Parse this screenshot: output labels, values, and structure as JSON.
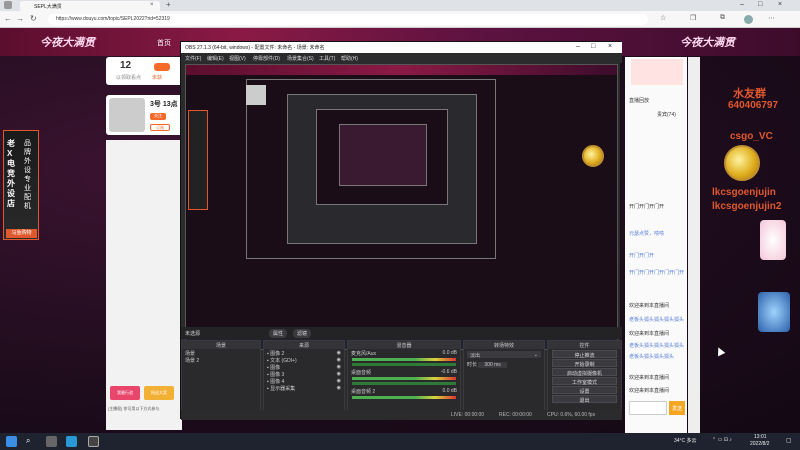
{
  "browser": {
    "tab_title": "SEPL大满贯",
    "url": "https://www.douyu.com/topic/SEPL2022?rid=52319"
  },
  "site": {
    "nav_home": "首页",
    "logo_left": "今夜大满贯",
    "logo_right": "今夜大满贯"
  },
  "follow_card": {
    "count": "12",
    "label": "以领取看点",
    "badge": "未获"
  },
  "room_card": {
    "title": "3号 13点",
    "follow": "关注",
    "subscribe": "订阅"
  },
  "left_ad": {
    "col1": "老X电竞外设店",
    "col2": "品牌外设 专业配机",
    "button": "马鱼购物"
  },
  "left_panel": {
    "bottom_label": "我最行战",
    "bottom_label2": "抢送大奖",
    "footer": "[主播权] 你可用以下方式参与"
  },
  "obs": {
    "title": "OBS 27.1.3 (64-bit, windows) - 配置文件: 未命名 - 场景: 未命名",
    "menu": [
      "文件(F)",
      "编辑(E)",
      "视图(V)",
      "停靠部件(D)",
      "场景集合(S)",
      "工具(T)",
      "帮助(H)"
    ],
    "scene_bar_label": "未选源",
    "scene_bar_props": "属性",
    "scene_bar_filters": "滤镜",
    "docks": {
      "scenes": {
        "header": "场景",
        "items": [
          "场景",
          "场景 2"
        ]
      },
      "sources": {
        "header": "来源",
        "items": [
          "图像 2",
          "文本 (GDI+)",
          "图像",
          "图像 3",
          "图像 4",
          "显示器采集"
        ]
      },
      "mixer": {
        "header": "混音器",
        "tracks": [
          {
            "name": "麦克风/Aux",
            "db": "0.0 dB"
          },
          {
            "name": "桌面音频",
            "db": "-0.6 dB"
          },
          {
            "name": "桌面音频 2",
            "db": "0.0 dB"
          }
        ]
      },
      "transitions": {
        "header": "转场特效",
        "type": "淡出",
        "duration_label": "时长",
        "duration": "300 ms"
      },
      "controls": {
        "header": "控件",
        "buttons": [
          "停止推流",
          "开始录制",
          "启动虚拟摄像机",
          "工作室模式",
          "设置",
          "退出"
        ]
      }
    },
    "status": {
      "live": "LIVE: 00:00:00",
      "rec": "REC: 00:00:00",
      "cpu": "CPU: 0.6%, 60.00 fps"
    }
  },
  "right_panel": {
    "tabs": [
      "直播回放",
      "贵宾(74)"
    ],
    "overlay1": "水友群",
    "overlay2": "640406797",
    "overlay3": "csgo_VC",
    "overlay4": "lkcsgoenjujin",
    "overlay5": "lkcsgoenjujin2",
    "chat_lines": [
      "开门开门开门开",
      "元瑟点赞，啧啧",
      "开门开门开",
      "开门开门开门开门开门开",
      "欢迎来到本直播间",
      "老板头狐头狐头狐头狐头",
      "欢迎来到本直播间",
      "老板头狐头狐头狐头狐头",
      "老板头狐头狐头狐头",
      "欢迎来到本直播间",
      "欢迎来到本直播间"
    ],
    "send_button": "发送"
  },
  "taskbar": {
    "weather": "34°C 多云",
    "time": "13:01",
    "date": "2022/8/2"
  }
}
